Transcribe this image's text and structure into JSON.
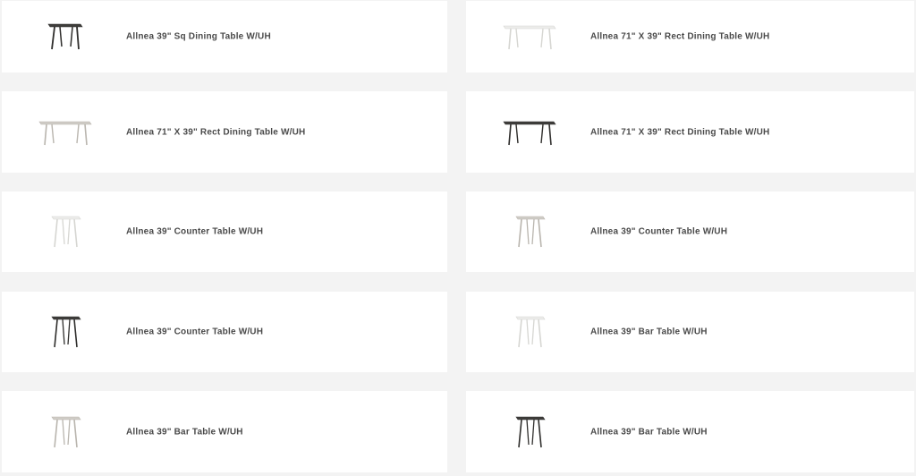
{
  "colors": {
    "page_bg": "#f3f3f3",
    "card_bg": "#ffffff",
    "text": "#4a4a4a",
    "dark_wood": "#3e3d3b",
    "light": "#ececea",
    "greige": "#cfccc6"
  },
  "products": [
    {
      "name": "Allnea 39\" Sq Dining Table W/UH",
      "icon": "square-table-icon",
      "finish": "dark",
      "shape": "square"
    },
    {
      "name": "Allnea 71\" X 39\" Rect Dining Table W/UH",
      "icon": "rect-table-icon",
      "finish": "light",
      "shape": "rect"
    },
    {
      "name": "Allnea 71\" X 39\" Rect Dining Table W/UH",
      "icon": "rect-table-icon",
      "finish": "greige",
      "shape": "rect"
    },
    {
      "name": "Allnea 71\" X 39\" Rect Dining Table W/UH",
      "icon": "rect-table-icon",
      "finish": "dark",
      "shape": "rect"
    },
    {
      "name": "Allnea 39\" Counter Table W/UH",
      "icon": "counter-table-icon",
      "finish": "light",
      "shape": "tall"
    },
    {
      "name": "Allnea 39\" Counter Table W/UH",
      "icon": "counter-table-icon",
      "finish": "greige",
      "shape": "tall"
    },
    {
      "name": "Allnea 39\" Counter Table W/UH",
      "icon": "counter-table-icon",
      "finish": "dark",
      "shape": "tall"
    },
    {
      "name": "Allnea 39\" Bar Table W/UH",
      "icon": "bar-table-icon",
      "finish": "light",
      "shape": "tall"
    },
    {
      "name": "Allnea 39\" Bar Table W/UH",
      "icon": "bar-table-icon",
      "finish": "greige",
      "shape": "tall"
    },
    {
      "name": "Allnea 39\" Bar Table W/UH",
      "icon": "bar-table-icon",
      "finish": "dark",
      "shape": "tall"
    }
  ]
}
